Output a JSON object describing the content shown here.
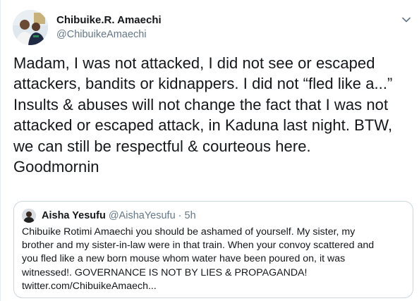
{
  "author": {
    "display_name": "Chibuike.R. Amaechi",
    "handle": "@ChibuikeAmaechi"
  },
  "tweet": {
    "lines": [
      "Madam, I was not attacked, I did not see or escaped",
      "attackers, bandits or kidnappers. I did not “fled like a...”",
      "Insults & abuses will not change the fact that I was not",
      "attacked or escaped attack, in Kaduna last night. BTW,",
      "we can still be respectful & courteous here.",
      "Goodmornin"
    ]
  },
  "quoted_tweet": {
    "display_name": "Aisha Yesufu",
    "handle": "@AishaYesufu",
    "separator": "·",
    "time": "5h",
    "lines": [
      "Chibuike Rotimi Amaechi you should be ashamed of yourself. My sister, my",
      "brother and my sister-in-law were in that train. When your convoy scattered and",
      "you fled like a new born mouse whom water have been poured on, it was",
      "witnessed!. GOVERNANCE IS NOT BY LIES & PROPAGANDA!",
      "twitter.com/ChibuikeAmaech..."
    ]
  },
  "icons": {
    "menu": "chevron-down-icon"
  },
  "colors": {
    "text_primary": "#14171a",
    "text_secondary": "#657786",
    "border": "#ccd6dd"
  }
}
